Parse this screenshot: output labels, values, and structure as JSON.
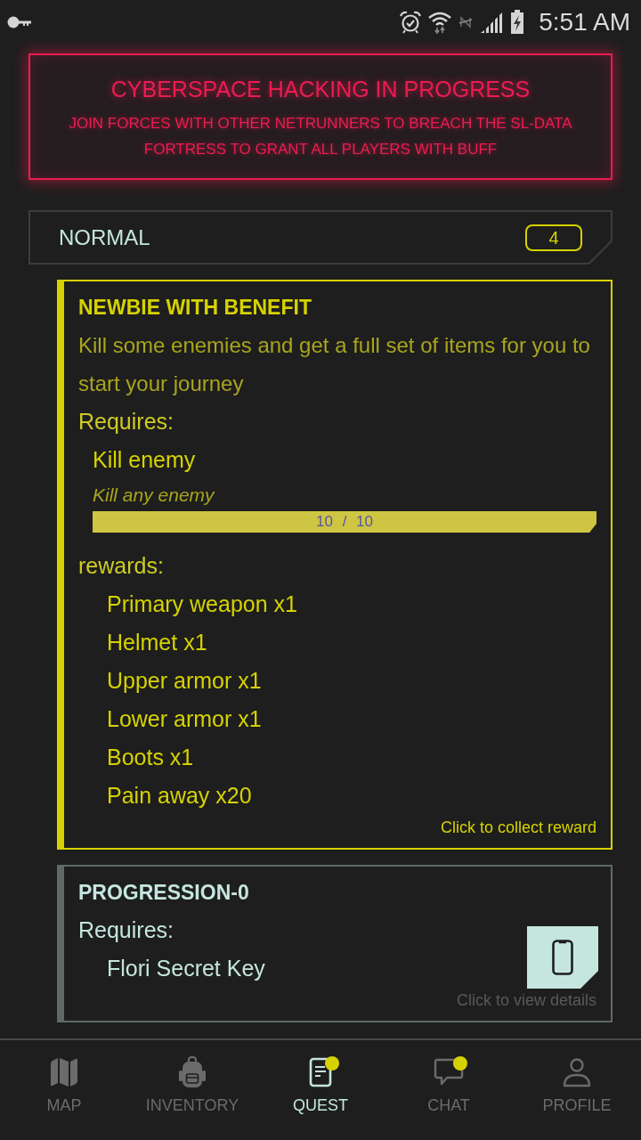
{
  "status_bar": {
    "time": "5:51 AM"
  },
  "banner": {
    "title": "CYBERSPACE HACKING IN PROGRESS",
    "message": "JOIN FORCES WITH OTHER NETRUNNERS TO BREACH THE SL-DATA FORTRESS TO GRANT ALL PLAYERS WITH BUFF"
  },
  "sections": [
    {
      "title": "NORMAL",
      "count": "4",
      "quests": [
        {
          "title": "NEWBIE WITH BENEFIT",
          "completed": true,
          "description": "Kill some enemies and get a full set of items for you to start your journey",
          "requires_label": "Requires:",
          "requirements": [
            {
              "name": "Kill enemy",
              "description": "Kill any enemy",
              "progress": "10 / 10",
              "level": 1
            }
          ],
          "rewards_label": "rewards:",
          "rewards": [
            "Primary weapon x1",
            "Helmet x1",
            "Upper armor x1",
            "Lower armor x1",
            "Boots x1",
            "Pain away x20"
          ],
          "action": "Click to collect reward"
        },
        {
          "title": "PROGRESSION-0",
          "completed": false,
          "requires_label": "Requires:",
          "requirements": [
            {
              "name": "Flori Secret Key"
            }
          ],
          "action": "Click to view details"
        }
      ]
    }
  ],
  "bottom_nav": [
    {
      "label": "MAP",
      "selected": false,
      "notification": false
    },
    {
      "label": "INVENTORY",
      "selected": false,
      "notification": false
    },
    {
      "label": "QUEST",
      "selected": true,
      "notification": true
    },
    {
      "label": "CHAT",
      "selected": false,
      "notification": true
    },
    {
      "label": "PROFILE",
      "selected": false,
      "notification": false
    }
  ]
}
